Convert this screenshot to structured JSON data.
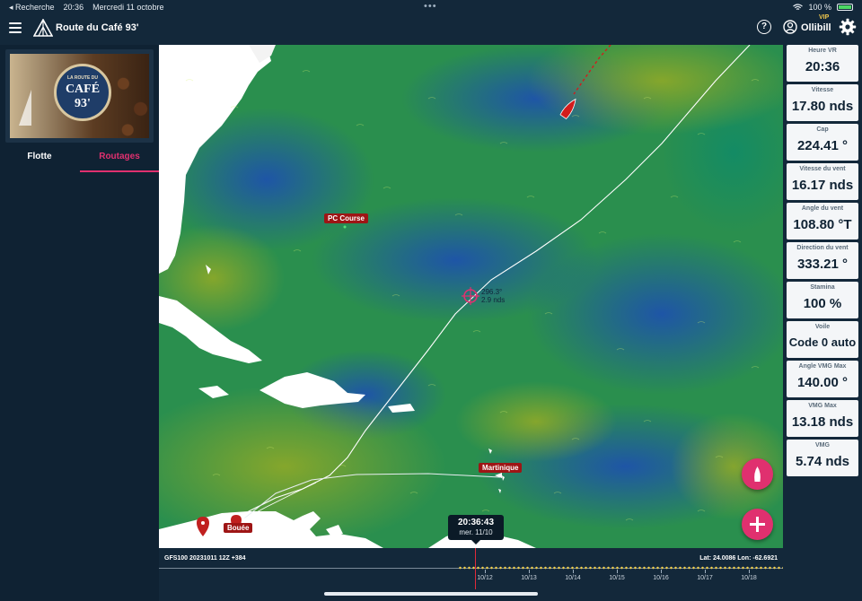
{
  "status_bar": {
    "back_app": "◂ Recherche",
    "time": "20:36",
    "date": "Mercredi 11 octobre",
    "dots": "•••",
    "battery": "100 %"
  },
  "header": {
    "title": "Route du Café 93'",
    "username": "Ollibill",
    "vip": "VIP",
    "help": "?"
  },
  "banner": {
    "line1": "LA ROUTE DU",
    "line2": "CAFÉ 93'"
  },
  "sidebar": {
    "tabs": [
      {
        "label": "Flotte",
        "active": false
      },
      {
        "label": "Routages",
        "active": true
      }
    ]
  },
  "map": {
    "labels": {
      "pc_course": "PC Course",
      "martinique": "Martinique",
      "bouee": "Bouée"
    },
    "crosshair": {
      "heading": "296.3°",
      "speed": "2.9 nds"
    }
  },
  "stats": [
    {
      "label": "Heure VR",
      "value": "20:36"
    },
    {
      "label": "Vitesse",
      "value": "17.80 nds"
    },
    {
      "label": "Cap",
      "value": "224.41 °"
    },
    {
      "label": "Vitesse du vent",
      "value": "16.17 nds"
    },
    {
      "label": "Angle du vent",
      "value": "108.80 °T"
    },
    {
      "label": "Direction du vent",
      "value": "333.21 °"
    },
    {
      "label": "Stamina",
      "value": "100 %"
    },
    {
      "label": "Voile",
      "value": "Code 0 auto"
    },
    {
      "label": "Angle VMG Max",
      "value": "140.00 °"
    },
    {
      "label": "VMG Max",
      "value": "13.18 nds"
    },
    {
      "label": "VMG",
      "value": "5.74 nds"
    }
  ],
  "timeline": {
    "model": "GFS100 20231011 12Z +384",
    "position": "Lat: 24.0086 Lon: -62.6921",
    "current_time": "20:36:43",
    "current_date": "mer. 11/10",
    "ticks": [
      "10/12",
      "10/13",
      "10/14",
      "10/15",
      "10/16",
      "10/17",
      "10/18"
    ]
  },
  "colors": {
    "accent": "#e0306f",
    "label_red": "#9e1515",
    "panel_bg": "#0f2233"
  }
}
